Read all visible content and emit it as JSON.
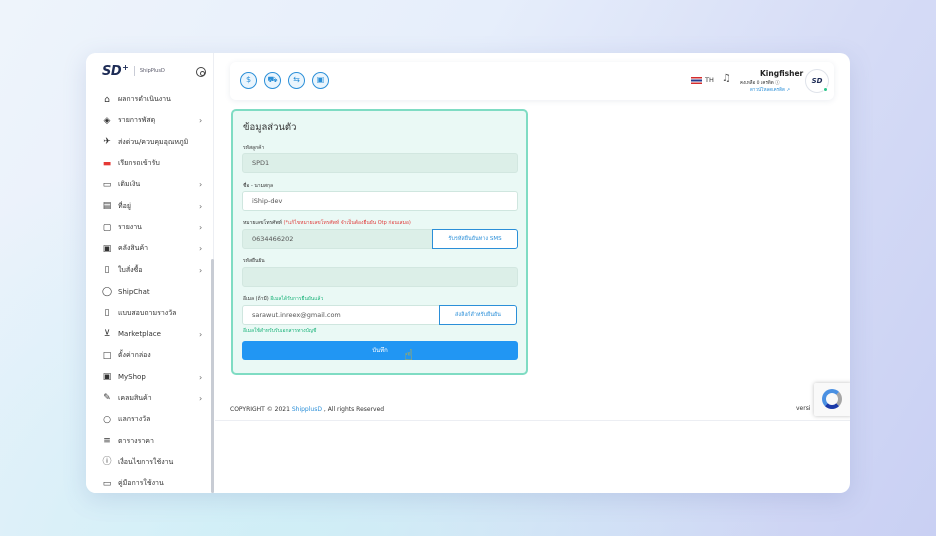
{
  "brand": {
    "logo": "SD",
    "plus": "+",
    "sub": "ShipPlusD"
  },
  "sidebar": {
    "items": [
      {
        "label": "ผลการดำเนินงาน",
        "icon": "home-icon",
        "chevron": false
      },
      {
        "label": "รายการพัสดุ",
        "icon": "box-icon",
        "chevron": true
      },
      {
        "label": "ส่งด่วน/ควบคุมอุณหภูมิ",
        "icon": "express-icon",
        "chevron": false
      },
      {
        "label": "เรียกรถเข้ารับ",
        "icon": "car-icon",
        "chevron": false
      },
      {
        "label": "เติมเงิน",
        "icon": "wallet-icon",
        "chevron": true
      },
      {
        "label": "ที่อยู่",
        "icon": "map-icon",
        "chevron": true
      },
      {
        "label": "รายงาน",
        "icon": "folder-icon",
        "chevron": true
      },
      {
        "label": "คลังสินค้า",
        "icon": "warehouse-icon",
        "chevron": true
      },
      {
        "label": "ใบสั่งซื้อ",
        "icon": "document-icon",
        "chevron": true
      },
      {
        "label": "ShipChat",
        "icon": "chat-icon",
        "chevron": false
      },
      {
        "label": "แบบสอบถามรางวัล",
        "icon": "survey-icon",
        "chevron": false
      },
      {
        "label": "Marketplace",
        "icon": "cart-icon",
        "chevron": true
      },
      {
        "label": "ตั้งค่ากล่อง",
        "icon": "square-icon",
        "chevron": false
      },
      {
        "label": "MyShop",
        "icon": "shop-icon",
        "chevron": true
      },
      {
        "label": "เคลมสินค้า",
        "icon": "wrench-icon",
        "chevron": true
      },
      {
        "label": "แลกรางวัล",
        "icon": "circle-icon",
        "chevron": false
      },
      {
        "label": "ตารางราคา",
        "icon": "list-icon",
        "chevron": false
      },
      {
        "label": "เงื่อนไขการใช้งาน",
        "icon": "info-icon",
        "chevron": false
      },
      {
        "label": "คู่มือการใช้งาน",
        "icon": "book-icon",
        "chevron": false
      }
    ]
  },
  "header": {
    "icons": [
      "dollar-icon",
      "truck-icon",
      "delivery-icon",
      "box-return-icon"
    ],
    "lang": "TH",
    "user_name": "Kingfisher",
    "credit_text": "คงเหลือ 0 เครดิต",
    "credit_link": "ดาวน์โหลดเครดิต",
    "avatar": "SD"
  },
  "form": {
    "title": "ข้อมูลส่วนตัว",
    "customer_code_label": "รหัสลูกค้า",
    "customer_code_value": "SPD1",
    "name_label": "ชื่อ - นามสกุล",
    "name_value": "iShip-dev",
    "phone_label": "หมายเลขโทรศัพท์",
    "phone_note": "(*แก้ไขหมายเลขโทรศัพท์ จำเป็นต้องยืนยัน Otp ก่อนเสมอ)",
    "phone_value": "0634466202",
    "phone_button": "รับรหัสยืนยันทาง SMS",
    "otp_label": "รหัสยืนยัน",
    "otp_value": "",
    "email_label": "อีเมล (ถ้ามี)",
    "email_note": "อีเมลได้รับการยืนยันแล้ว",
    "email_value": "sarawut.inreex@gmail.com",
    "email_button": "ส่งลิงก์สำหรับยืนยัน",
    "email_hint": "อีเมลใช้สำหรับรับเอกสารทางบัญชี",
    "save_label": "บันทึก"
  },
  "footer": {
    "copyright": "COPYRIGHT © 2021",
    "brand_link": "ShipplusD",
    "rights": ", All rights Reserved",
    "version": "versi"
  }
}
